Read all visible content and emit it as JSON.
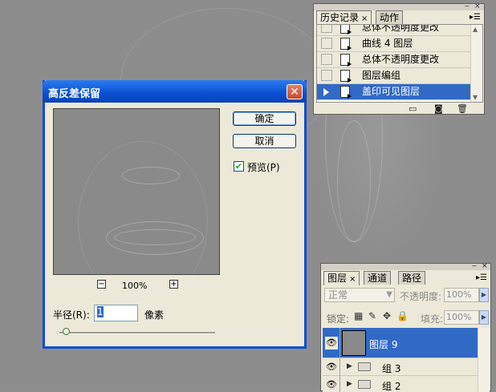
{
  "history_panel": {
    "tabs": [
      {
        "label": "历史记录",
        "close": "×"
      },
      {
        "label": "动作"
      }
    ],
    "items": [
      {
        "label": "总体不透明度更改"
      },
      {
        "label": "曲线 4 图层"
      },
      {
        "label": "总体不透明度更改"
      },
      {
        "label": "图层编组"
      },
      {
        "label": "盖印可见图层",
        "selected": true
      }
    ],
    "menu_icon": "panel-menu-icon",
    "footer_icons": [
      "new-document-icon",
      "camera-snapshot-icon",
      "trash-icon"
    ]
  },
  "dialog": {
    "title": "高反差保留",
    "ok_label": "确定",
    "cancel_label": "取消",
    "preview_label": "预览(P)",
    "preview_checked": true,
    "zoom_level": "100%",
    "zoom_minus": "−",
    "zoom_plus": "+",
    "radius_label": "半径(R):",
    "radius_value": "1",
    "unit": "像素",
    "close": "✕"
  },
  "layers_panel": {
    "tabs": [
      {
        "label": "图层",
        "close": "×"
      },
      {
        "label": "通道"
      },
      {
        "label": "路径"
      }
    ],
    "blend_mode": "正常",
    "opacity_label": "不透明度:",
    "opacity_value": "100%",
    "lock_label": "锁定:",
    "fill_label": "填充:",
    "fill_value": "100%",
    "layers": [
      {
        "name": "图层 9",
        "selected": true,
        "type": "layer"
      },
      {
        "name": "组 3",
        "type": "group"
      },
      {
        "name": "组 2",
        "type": "group"
      }
    ]
  },
  "colors": {
    "canvas": "#8d8d8d",
    "selection": "#316ac5",
    "titlebar": "#0a4fd1",
    "panel": "#ece9d8"
  }
}
